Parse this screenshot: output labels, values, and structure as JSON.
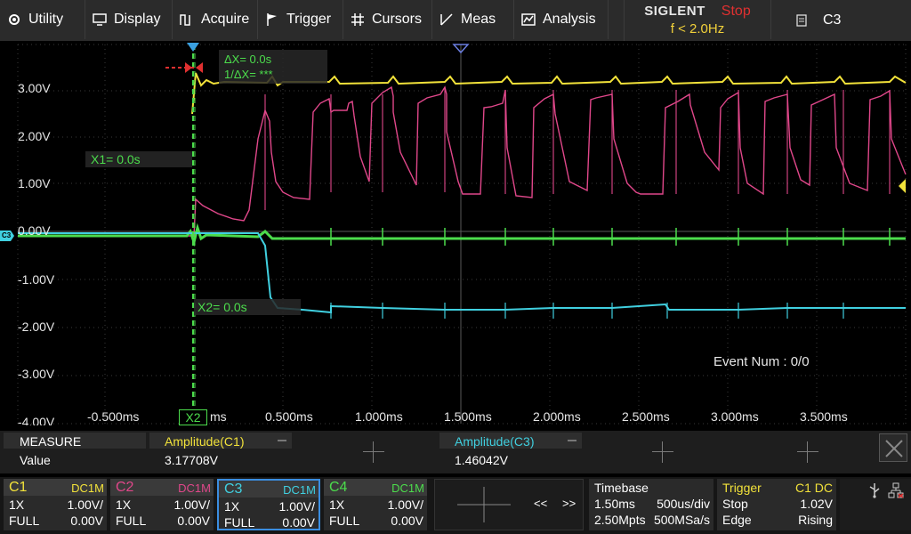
{
  "menu": {
    "items": [
      {
        "label": "Utility",
        "icon": "gear-icon"
      },
      {
        "label": "Display",
        "icon": "monitor-icon"
      },
      {
        "label": "Acquire",
        "icon": "acquire-icon"
      },
      {
        "label": "Trigger",
        "icon": "flag-icon"
      },
      {
        "label": "Cursors",
        "icon": "crosshair-icon"
      },
      {
        "label": "Meas",
        "icon": "ruler-icon"
      },
      {
        "label": "Analysis",
        "icon": "analysis-icon"
      }
    ],
    "brand": "SIGLENT",
    "run_state": "Stop",
    "trigger_freq": "f < 2.0Hz",
    "active_channel": "C3"
  },
  "grid": {
    "y_labels": [
      "3.00V",
      "2.00V",
      "1.00V",
      "0.00V",
      "-1.00V",
      "-2.00V",
      "-3.00V",
      "-4.00V"
    ],
    "x_labels": [
      "-0.500ms",
      "ms",
      "0.500ms",
      "1.000ms",
      "1.500ms",
      "2.000ms",
      "2.500ms",
      "3.000ms",
      "3.500ms"
    ],
    "channel_marker": "C3"
  },
  "cursors": {
    "delta_x": "ΔX= 0.0s",
    "inv_delta_x": "1/ΔX= ***",
    "x1": "X1= 0.0s",
    "x2": "X2= 0.0s",
    "x2_tag": "X2"
  },
  "event_num": "Event Num : 0/0",
  "measure": {
    "title": "MEASURE",
    "value_label": "Value",
    "m1_name": "Amplitude(C1)",
    "m1_value": "3.17708V",
    "m2_name": "Amplitude(C3)",
    "m2_value": "1.46042V"
  },
  "channels": [
    {
      "name": "C1",
      "coupling": "DC1M",
      "probe": "1X",
      "scale": "1.00V/",
      "bw": "FULL",
      "offset": "0.00V",
      "color": "#f2e23a"
    },
    {
      "name": "C2",
      "coupling": "DC1M",
      "probe": "1X",
      "scale": "1.00V/",
      "bw": "FULL",
      "offset": "0.00V",
      "color": "#e0478a"
    },
    {
      "name": "C3",
      "coupling": "DC1M",
      "probe": "1X",
      "scale": "1.00V/",
      "bw": "FULL",
      "offset": "0.00V",
      "color": "#40d0e0"
    },
    {
      "name": "C4",
      "coupling": "DC1M",
      "probe": "1X",
      "scale": "1.00V/",
      "bw": "FULL",
      "offset": "0.00V",
      "color": "#4cdc4c"
    }
  ],
  "nav": {
    "left": "<<",
    "right": ">>"
  },
  "timebase": {
    "title": "Timebase",
    "delay": "1.50ms",
    "scale": "500us/div",
    "memory": "2.50Mpts",
    "rate": "500MSa/s"
  },
  "trigger": {
    "title": "Trigger",
    "source": "C1 DC",
    "state": "Stop",
    "level": "1.02V",
    "type": "Edge",
    "slope": "Rising"
  }
}
